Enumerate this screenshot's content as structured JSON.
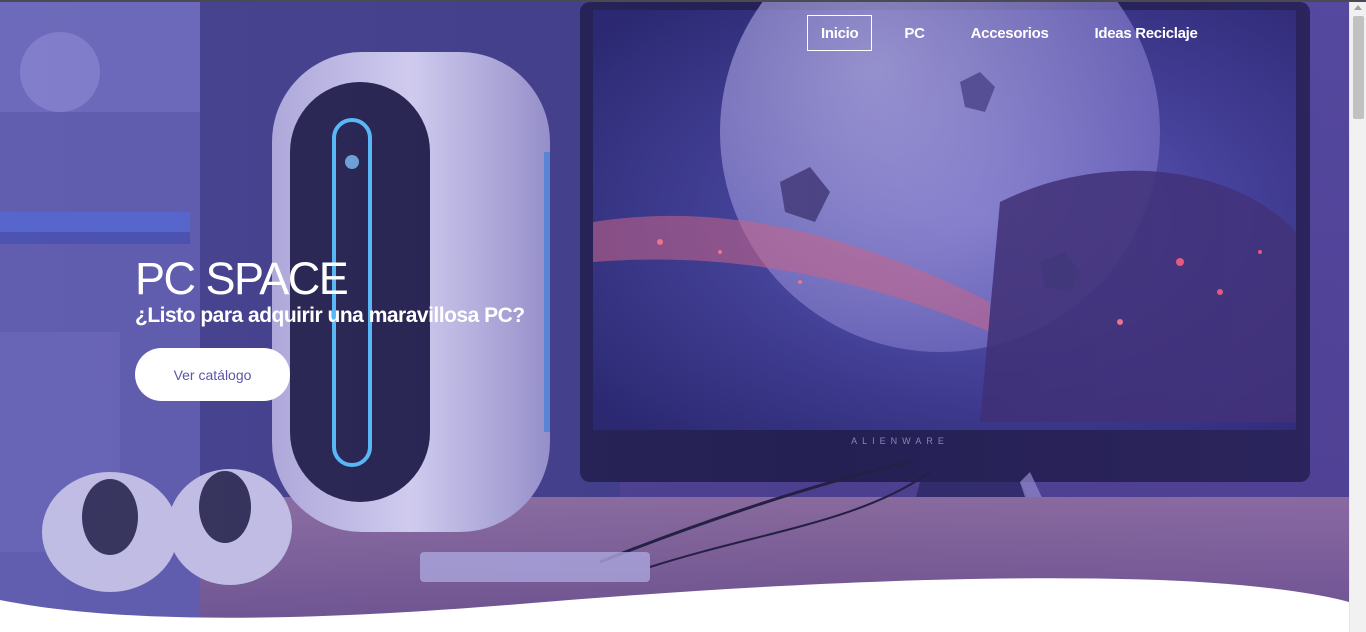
{
  "nav": {
    "items": [
      {
        "label": "Inicio",
        "active": true
      },
      {
        "label": "PC",
        "active": false
      },
      {
        "label": "Accesorios",
        "active": false
      },
      {
        "label": "Ideas Reciclaje",
        "active": false
      }
    ]
  },
  "hero": {
    "title": "PC SPACE",
    "subtitle": "¿Listo para adquirir una maravillosa PC?",
    "cta_label": "Ver catálogo",
    "monitor_brand": "ALIENWARE"
  },
  "colors": {
    "hero_tint": "#4e4796",
    "cta_text": "#5a55a8",
    "white": "#ffffff"
  }
}
